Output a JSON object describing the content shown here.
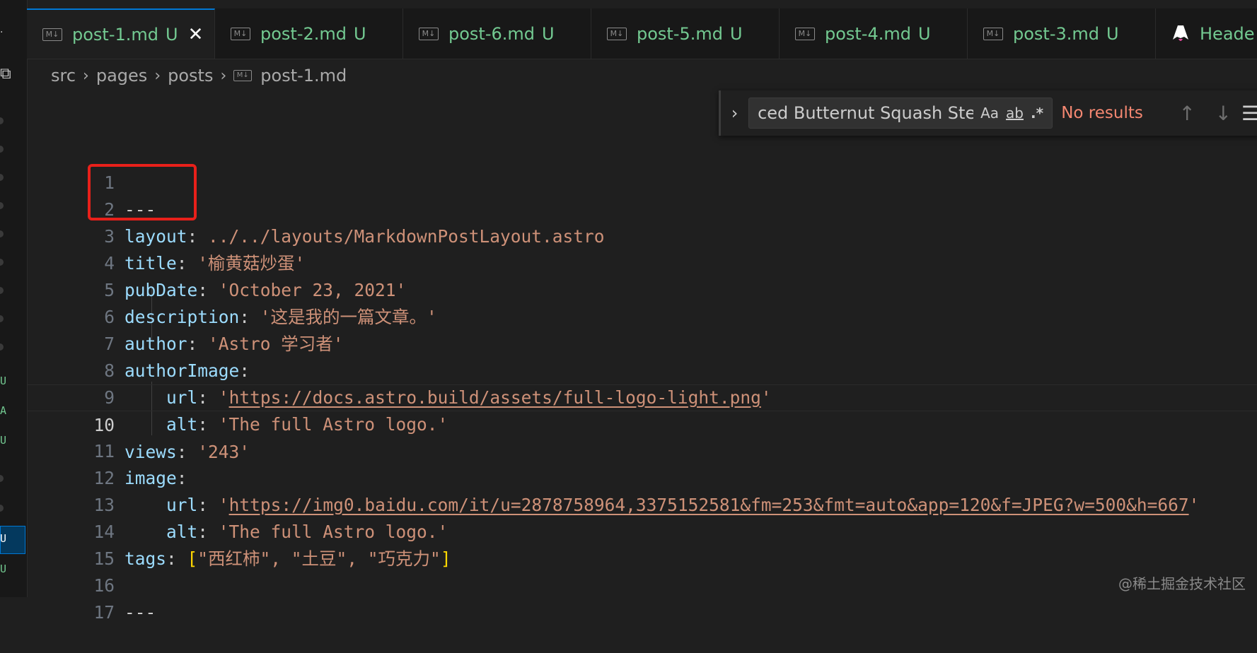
{
  "tabs": [
    {
      "name": "post-1.md",
      "status": "U",
      "close": "✕",
      "active": true
    },
    {
      "name": "post-2.md",
      "status": "U"
    },
    {
      "name": "post-6.md",
      "status": "U"
    },
    {
      "name": "post-5.md",
      "status": "U"
    },
    {
      "name": "post-4.md",
      "status": "U"
    },
    {
      "name": "post-3.md",
      "status": "U"
    },
    {
      "name": "Heade",
      "status": ""
    }
  ],
  "md_icon_label": "M↓",
  "breadcrumb": {
    "items": [
      "src",
      "pages",
      "posts",
      "post-1.md"
    ],
    "separator": "›"
  },
  "find": {
    "query": "ced Butternut Squash Stew",
    "match_case": "Aa",
    "whole_word": "ab",
    "regex": ".*",
    "result": "No results",
    "prev": "↑",
    "next": "↓",
    "menu": "☰",
    "toggle": "›"
  },
  "editor": {
    "lines": [
      {
        "n": "1",
        "dash": "---"
      },
      {
        "n": "2",
        "key": "layout",
        "sep": ": ",
        "val": "../../layouts/MarkdownPostLayout.astro"
      },
      {
        "n": "3",
        "key": "title",
        "sep": ": ",
        "val": "'榆黄菇炒蛋'"
      },
      {
        "n": "4",
        "key": "pubDate",
        "sep": ": ",
        "val": "'October 23, 2021'"
      },
      {
        "n": "5",
        "key": "description",
        "sep": ": ",
        "val": "'这是我的一篇文章。'"
      },
      {
        "n": "6",
        "key": "author",
        "sep": ": ",
        "val": "'Astro 学习者'"
      },
      {
        "n": "7",
        "key": "authorImage",
        "sep": ":",
        "val": ""
      },
      {
        "n": "8",
        "key": "url",
        "sep": ": ",
        "q1": "'",
        "url": "https://docs.astro.build/assets/full-logo-light.png",
        "q2": "'"
      },
      {
        "n": "9",
        "key": "alt",
        "sep": ": ",
        "val": "'The full Astro logo.'"
      },
      {
        "n": "10",
        "key": "views",
        "sep": ": ",
        "val": "'243'"
      },
      {
        "n": "11",
        "key": "image",
        "sep": ":",
        "val": ""
      },
      {
        "n": "12",
        "key": "url",
        "sep": ": ",
        "q1": "'",
        "url": "https://img0.baidu.com/it/u=2878758964,3375152581&fm=253&fmt=auto&app=120&f=JPEG?w=500&h=667",
        "q2": "'"
      },
      {
        "n": "13",
        "key": "alt",
        "sep": ": ",
        "val": "'The full Astro logo.'"
      },
      {
        "n": "14",
        "key": "tags",
        "sep": ": ",
        "open": "[",
        "tags": "\"西红柿\", \"土豆\", \"巧克力\"",
        "close": "]"
      },
      {
        "n": "15"
      },
      {
        "n": "16",
        "dash": "---"
      },
      {
        "n": "17"
      }
    ]
  },
  "left_marks": [
    "U",
    "A",
    "U",
    "U",
    "U"
  ],
  "watermark": "@稀土掘金技术社区",
  "colors": {
    "key": "#9cdcfe",
    "string": "#ce9178",
    "untracked": "#73c991",
    "highlight": "#e8201a",
    "accent": "#0078d4"
  }
}
